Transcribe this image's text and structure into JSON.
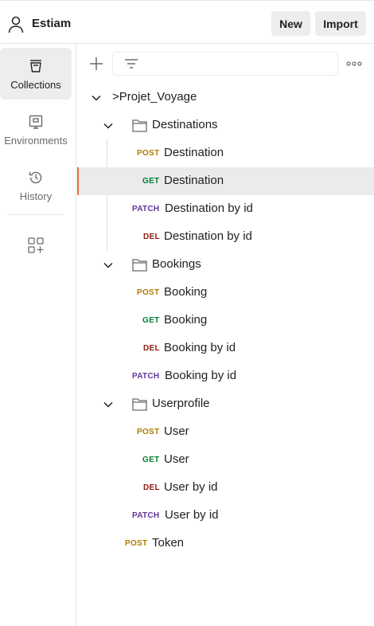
{
  "workspace": {
    "name": "Estiam"
  },
  "header": {
    "new_label": "New",
    "import_label": "Import"
  },
  "sidebar": {
    "items": [
      {
        "label": "Collections",
        "icon": "collections-icon"
      },
      {
        "label": "Environments",
        "icon": "environments-icon"
      },
      {
        "label": "History",
        "icon": "history-icon"
      }
    ]
  },
  "toolbar": {
    "search_placeholder": ""
  },
  "tree": {
    "collection": ">Projet_Voyage",
    "folders": [
      {
        "name": "Destinations",
        "requests": [
          {
            "method": "POST",
            "name": "Destination"
          },
          {
            "method": "GET",
            "name": "Destination"
          },
          {
            "method": "PATCH",
            "name": "Destination by id"
          },
          {
            "method": "DEL",
            "name": "Destination by id"
          }
        ]
      },
      {
        "name": "Bookings",
        "requests": [
          {
            "method": "POST",
            "name": "Booking"
          },
          {
            "method": "GET",
            "name": "Booking"
          },
          {
            "method": "DEL",
            "name": "Booking by id"
          },
          {
            "method": "PATCH",
            "name": "Booking by id"
          }
        ]
      },
      {
        "name": "Userprofile",
        "requests": [
          {
            "method": "POST",
            "name": "User"
          },
          {
            "method": "GET",
            "name": "User"
          },
          {
            "method": "DEL",
            "name": "User by id"
          },
          {
            "method": "PATCH",
            "name": "User by id"
          }
        ]
      }
    ],
    "root_requests": [
      {
        "method": "POST",
        "name": "Token"
      }
    ]
  },
  "colors": {
    "post": "#ad7a03",
    "get": "#007f31",
    "del": "#8e1a10",
    "patch": "#623497",
    "selected_accent": "#f26b3a"
  }
}
